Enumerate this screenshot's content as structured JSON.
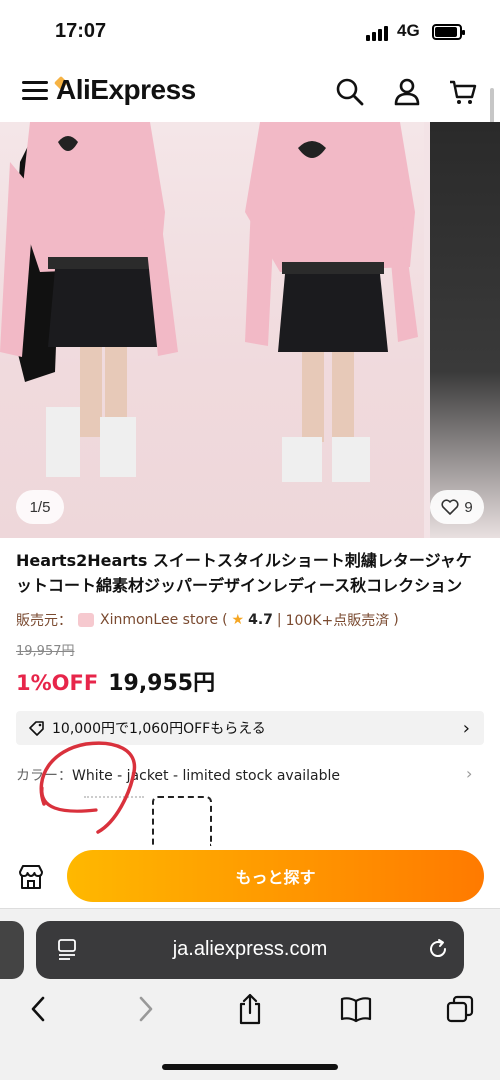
{
  "status_bar": {
    "time": "17:07",
    "network": "4G"
  },
  "header": {
    "logo": "AliExpress",
    "icons": [
      "menu-icon",
      "search-icon",
      "account-icon",
      "cart-icon"
    ]
  },
  "gallery": {
    "image_counter": "1/5",
    "wishlist_count": "9"
  },
  "product": {
    "title": "Hearts2Hearts スイートスタイルショート刺繍レタージャケットコート綿素材ジッパーデザインレディース秋コレクション",
    "seller_label": "販売元：",
    "store_name": "XinmonLee store",
    "rating": "4.7",
    "sold": "100K+点販売済",
    "original_price": "19,957円",
    "discount": "1%OFF",
    "price": "19,955円",
    "coupon_text": "10,000円で1,060円OFFもらえる",
    "color_label": "カラー：",
    "color_value": "White - jacket - limited stock available"
  },
  "action_bar": {
    "cta_label": "もっと探す"
  },
  "browser": {
    "url": "ja.aliexpress.com"
  },
  "colors": {
    "accent_red": "#e7254a",
    "cta_start": "#ffb800",
    "cta_end": "#ff7a00",
    "annotation_red": "#d9313c"
  }
}
